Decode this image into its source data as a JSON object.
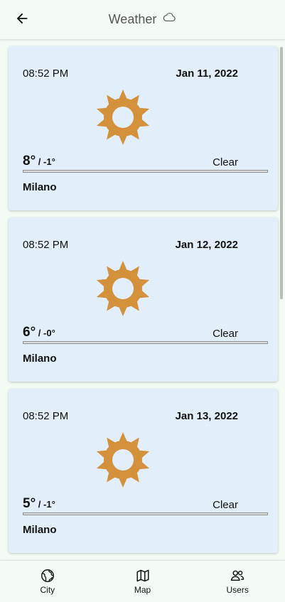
{
  "header": {
    "title": "Weather",
    "back_icon": "arrow-left-icon",
    "title_icon": "cloud-icon"
  },
  "forecasts": [
    {
      "time": "08:52 PM",
      "date": "Jan 11, 2022",
      "temp_high": "8°",
      "temp_low": " / -1°",
      "condition": "Clear",
      "city": "Milano",
      "icon": "sun-icon"
    },
    {
      "time": "08:52 PM",
      "date": "Jan 12, 2022",
      "temp_high": "6°",
      "temp_low": " / -0°",
      "condition": "Clear",
      "city": "Milano",
      "icon": "sun-icon"
    },
    {
      "time": "08:52 PM",
      "date": "Jan 13, 2022",
      "temp_high": "5°",
      "temp_low": " / -1°",
      "condition": "Clear",
      "city": "Milano",
      "icon": "sun-icon"
    }
  ],
  "bottom_nav": [
    {
      "label": "City",
      "icon": "globe-icon"
    },
    {
      "label": "Map",
      "icon": "map-icon"
    },
    {
      "label": "Users",
      "icon": "users-icon"
    }
  ],
  "colors": {
    "background": "#f3fbf4",
    "card": "#e3eefb",
    "sun": "#d4913b"
  }
}
